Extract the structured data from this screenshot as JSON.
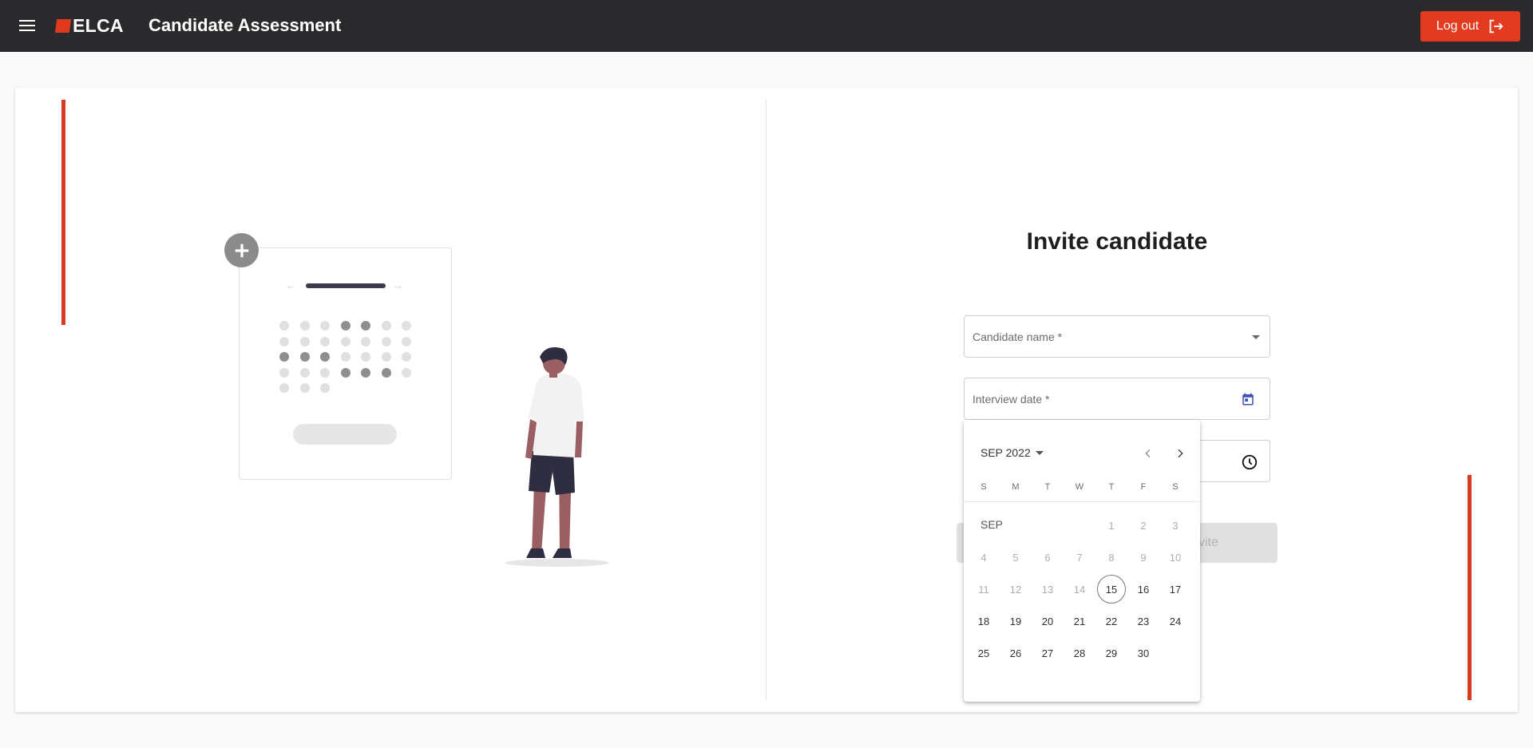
{
  "header": {
    "logo_text": "ELCA",
    "title": "Candidate Assessment",
    "logout_label": "Log out",
    "brand_color": "#e33b1f"
  },
  "form": {
    "title": "Invite candidate",
    "candidate_label": "Candidate name *",
    "date_label": "Interview date *",
    "invite_label": "vite"
  },
  "datepicker": {
    "period": "SEP 2022",
    "month_label": "SEP",
    "weekdays": [
      "S",
      "M",
      "T",
      "W",
      "T",
      "F",
      "S"
    ],
    "weeks": [
      [
        null,
        null,
        null,
        null,
        "1",
        "2",
        "3"
      ],
      [
        "4",
        "5",
        "6",
        "7",
        "8",
        "9",
        "10"
      ],
      [
        "11",
        "12",
        "13",
        "14",
        "15",
        "16",
        "17"
      ],
      [
        "18",
        "19",
        "20",
        "21",
        "22",
        "23",
        "24"
      ],
      [
        "25",
        "26",
        "27",
        "28",
        "29",
        "30",
        null
      ]
    ],
    "today": "15",
    "first_enabled": 15
  },
  "icons": {
    "menu": "menu-icon",
    "logout": "logout-icon",
    "calendar": "calendar-icon",
    "clock": "clock-icon",
    "prev": "chevron-left-icon",
    "next": "chevron-right-icon",
    "plus": "plus-icon"
  }
}
